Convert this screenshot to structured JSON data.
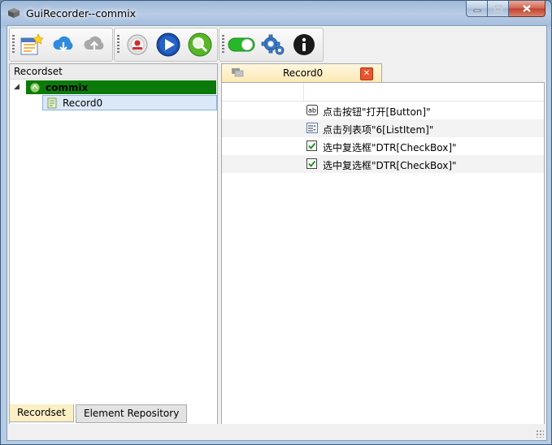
{
  "window": {
    "title": "GuiRecorder--commix"
  },
  "toolbar": {
    "buttons": [
      {
        "icon": "new-record-icon"
      },
      {
        "icon": "cloud-download-icon"
      },
      {
        "icon": "cloud-upload-icon"
      },
      {
        "icon": "record-icon"
      },
      {
        "icon": "play-icon"
      },
      {
        "icon": "inspect-icon"
      },
      {
        "icon": "toggle-on-icon"
      },
      {
        "icon": "settings-icon"
      },
      {
        "icon": "info-icon"
      }
    ]
  },
  "left_panel": {
    "header": "Recordset",
    "tree": {
      "root": "commix",
      "child": "Record0"
    },
    "tabs": [
      {
        "label": "Recordset"
      },
      {
        "label": "Element Repository"
      }
    ]
  },
  "right_panel": {
    "tab_label": "Record0",
    "steps": [
      {
        "icon": "textbox-icon",
        "text": "点击按钮\"打开[Button]\""
      },
      {
        "icon": "listitem-icon",
        "text": "点击列表项\"6[ListItem]\""
      },
      {
        "icon": "checkbox-icon",
        "text": "选中复选框\"DTR[CheckBox]\""
      },
      {
        "icon": "checkbox-icon",
        "text": "选中复选框\"DTR[CheckBox]\""
      }
    ]
  },
  "colors": {
    "tree_selected": "#0b7a0b",
    "tab_active": "#fbefc5",
    "close_red": "#e8542e"
  }
}
